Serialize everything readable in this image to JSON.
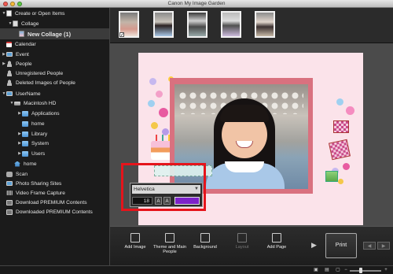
{
  "window": {
    "title": "Canon My Image Garden"
  },
  "sidebar": {
    "items": [
      {
        "label": "Create or Open Items",
        "icon": "page-icon"
      },
      {
        "label": "Collage",
        "icon": "collage-icon"
      },
      {
        "label": "New Collage (1)",
        "icon": "collage-page-icon"
      },
      {
        "label": "Calendar",
        "icon": "calendar-icon"
      },
      {
        "label": "Event",
        "icon": "event-icon"
      },
      {
        "label": "People",
        "icon": "people-icon"
      },
      {
        "label": "Unregistered People",
        "icon": "person-icon"
      },
      {
        "label": "Deleted Images of People",
        "icon": "person-icon"
      },
      {
        "label": "UserName",
        "icon": "computer-icon"
      },
      {
        "label": "Macintosh HD",
        "icon": "drive-icon"
      },
      {
        "label": "Applications",
        "icon": "folder-icon"
      },
      {
        "label": "home",
        "icon": "folder-icon"
      },
      {
        "label": "Library",
        "icon": "folder-icon"
      },
      {
        "label": "System",
        "icon": "folder-icon"
      },
      {
        "label": "Users",
        "icon": "folder-icon"
      },
      {
        "label": "home",
        "icon": "home-icon"
      },
      {
        "label": "Scan",
        "icon": "scan-icon"
      },
      {
        "label": "Photo Sharing Sites",
        "icon": "share-icon"
      },
      {
        "label": "Video Frame Capture",
        "icon": "film-icon"
      },
      {
        "label": "Download PREMIUM Contents",
        "icon": "download-icon"
      },
      {
        "label": "Downloaded PREMIUM Contents",
        "icon": "download-icon"
      }
    ]
  },
  "editor": {
    "font": {
      "name": "Helvetica",
      "size": "18",
      "color": "#7d22c9"
    }
  },
  "toolbar": {
    "add_image": "Add Image",
    "theme_main_people": "Theme and Main People",
    "background": "Background",
    "layout": "Layout",
    "add_page": "Add Page",
    "print": "Print"
  },
  "colors": {
    "highlight": "#e5141b",
    "frame": "#d9717f",
    "page": "#fbe3ea"
  }
}
